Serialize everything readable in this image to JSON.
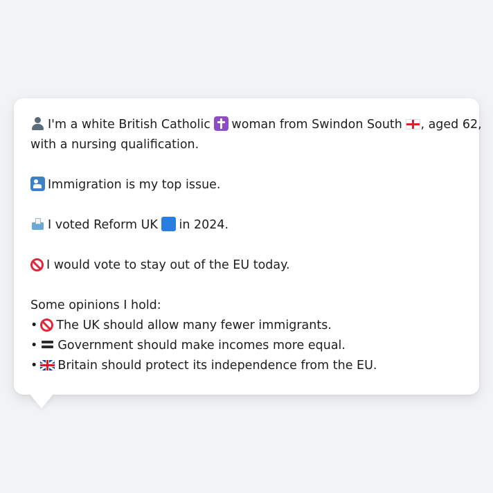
{
  "profile": {
    "intro_part1": "I'm a white British Catholic",
    "intro_part2": "woman from Swindon South",
    "intro_part3": ", aged 62,",
    "intro_line2": "with a nursing qualification.",
    "top_issue": "Immigration is my top issue.",
    "vote_part1": "I voted Reform UK",
    "vote_part2": "in 2024.",
    "eu_stance": "I would vote to stay out of the EU today.",
    "opinions_heading": "Some opinions I hold:",
    "opinions": [
      {
        "icon": "prohibited-icon",
        "text": "The UK should allow many fewer immigrants."
      },
      {
        "icon": "equals-icon",
        "text": "Government should make incomes more equal."
      },
      {
        "icon": "uk-flag-icon",
        "text": "Britain should protect its independence from the EU."
      }
    ]
  },
  "icons": {
    "intro": "person-icon",
    "religion": "latin-cross-icon",
    "region": "england-flag-icon",
    "issue": "passport-control-icon",
    "vote": "ballot-box-icon",
    "party": "blue-square-icon",
    "eu": "prohibited-icon"
  },
  "colors": {
    "background": "#f2f3f5",
    "bubble": "#ffffff",
    "text": "#1d1d1f",
    "party_blue": "#2a7de1"
  }
}
